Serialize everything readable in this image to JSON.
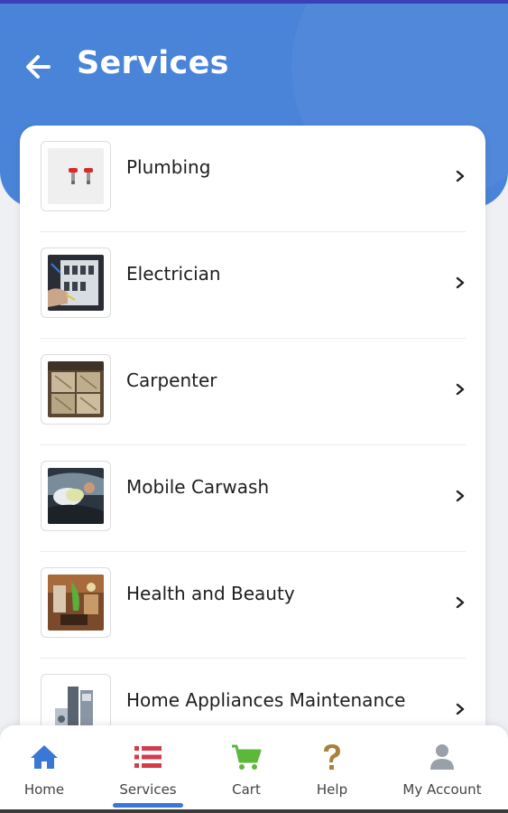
{
  "header": {
    "title": "Services",
    "background": "#4a84d8",
    "back_icon": "arrow-left-icon"
  },
  "services": [
    {
      "label": "Plumbing",
      "icon": "plumbing-thumbnail"
    },
    {
      "label": "Electrician",
      "icon": "electrician-thumbnail"
    },
    {
      "label": "Carpenter",
      "icon": "carpenter-thumbnail"
    },
    {
      "label": "Mobile Carwash",
      "icon": "carwash-thumbnail"
    },
    {
      "label": "Health and Beauty",
      "icon": "beauty-thumbnail"
    },
    {
      "label": "Home Appliances Maintenance",
      "icon": "appliances-thumbnail"
    }
  ],
  "bottom_nav": {
    "active": "Services",
    "items": [
      {
        "label": "Home",
        "icon": "home-icon",
        "color": "#3a78d8"
      },
      {
        "label": "Services",
        "icon": "list-icon",
        "color": "#d43a4a"
      },
      {
        "label": "Cart",
        "icon": "cart-icon",
        "color": "#5cb83a"
      },
      {
        "label": "Help",
        "icon": "question-icon",
        "color": "#a8823a"
      },
      {
        "label": "My Account",
        "icon": "user-icon",
        "color": "#9aa0a8"
      }
    ]
  }
}
